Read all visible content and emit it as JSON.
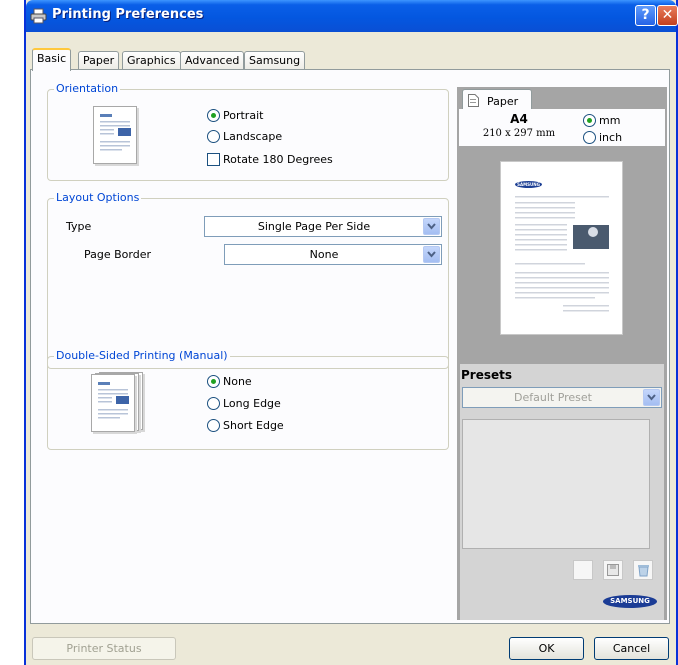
{
  "window": {
    "title": "Printing Preferences",
    "help_label": "?",
    "close_label": "✕"
  },
  "tabs": [
    "Basic",
    "Paper",
    "Graphics",
    "Advanced",
    "Samsung"
  ],
  "orientation": {
    "legend": "Orientation",
    "options": [
      "Portrait",
      "Landscape"
    ],
    "selected": "Portrait",
    "rotate_label": "Rotate 180 Degrees",
    "rotate_checked": false
  },
  "layout": {
    "legend": "Layout Options",
    "type_label": "Type",
    "type_value": "Single Page Per Side",
    "border_label": "Page Border",
    "border_value": "None"
  },
  "duplex": {
    "legend": "Double-Sided Printing (Manual)",
    "options": [
      "None",
      "Long Edge",
      "Short Edge"
    ],
    "selected": "None"
  },
  "preview": {
    "tab_label": "Paper",
    "paper_size": "A4",
    "paper_dims": "210 x 297 mm",
    "unit_mm": "mm",
    "unit_inch": "inch",
    "unit_selected": "mm",
    "page_logo": "SAMSUNG"
  },
  "presets": {
    "title": "Presets",
    "value": "Default Preset"
  },
  "brand": {
    "logo": "SAMSUNG"
  },
  "footer": {
    "status": "Printer Status",
    "ok": "OK",
    "cancel": "Cancel"
  },
  "colors": {
    "titlebar": "#0457e0",
    "legend_text": "#0046d5",
    "panel_bg": "#ece9d8",
    "radio_dot": "#21a121"
  }
}
